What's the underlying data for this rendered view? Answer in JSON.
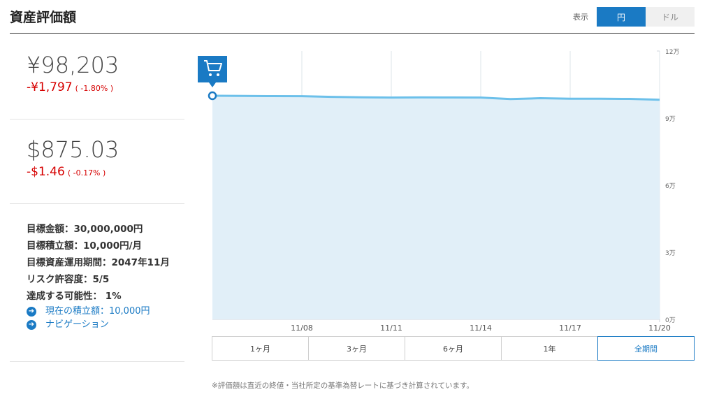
{
  "header": {
    "title": "資産評価額",
    "display_label": "表示",
    "currency_yen": "円",
    "currency_usd": "ドル"
  },
  "yen_block": {
    "value": "¥98,203",
    "change": "-¥1,797",
    "change_pct": "( -1.80% )"
  },
  "usd_block": {
    "value": "$875.03",
    "change": "-$1.46",
    "change_pct": "( -0.17% )"
  },
  "info": {
    "goal": "目標金額：30,000,000円",
    "monthly": "目標積立額：10,000円/月",
    "period": "目標資産運用期間：2047年11月",
    "risk": "リスク許容度：5/5",
    "probability": "達成する可能性： 1%"
  },
  "links": {
    "current": "現在の積立額：10,000円",
    "nav": "ナビゲーション"
  },
  "range_buttons": [
    "1ヶ月",
    "3ヶ月",
    "6ヶ月",
    "1年",
    "全期間"
  ],
  "active_range": "全期間",
  "note": "※評価額は直近の終値・当社所定の基準為替レートに基づき計算されています。",
  "colors": {
    "accent": "#1a7ac4",
    "line": "#6cc0ea",
    "area": "#e1eff8",
    "negative": "#d60000"
  },
  "chart_data": {
    "type": "area",
    "x": [
      "2017-11-05",
      "2017-11-06",
      "2017-11-07",
      "2017-11-08",
      "2017-11-09",
      "2017-11-10",
      "2017-11-11",
      "2017-11-12",
      "2017-11-13",
      "2017-11-14",
      "2017-11-15",
      "2017-11-16",
      "2017-11-17",
      "2017-11-18",
      "2017-11-19",
      "2017-11-20"
    ],
    "values": [
      100000,
      99900,
      99850,
      99800,
      99500,
      99300,
      99200,
      99250,
      99220,
      99200,
      98500,
      98900,
      98700,
      98650,
      98600,
      98203
    ],
    "x_ticks": [
      "11/08",
      "11/11",
      "11/14",
      "11/17",
      "11/20"
    ],
    "y_ticks": [
      "0万",
      "3万",
      "6万",
      "9万",
      "12万"
    ],
    "y_tick_values": [
      0,
      30000,
      60000,
      90000,
      120000
    ],
    "ylim": [
      0,
      120000
    ],
    "annotations": [
      {
        "x": "2017-11-05",
        "icon": "cart-icon"
      }
    ],
    "grid": true
  }
}
